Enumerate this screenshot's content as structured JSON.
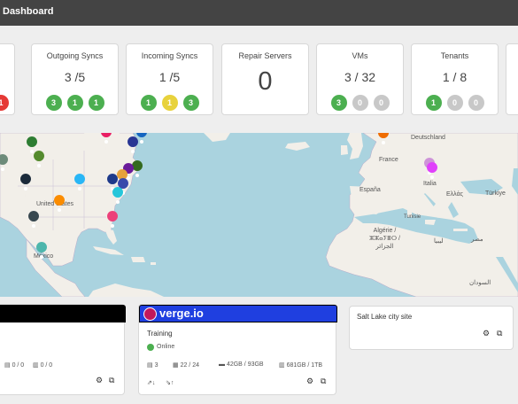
{
  "header": {
    "title": "Dashboard"
  },
  "stats": [
    {
      "title": "Outgoing Syncs",
      "value": "3 /5",
      "badges": [
        "3",
        "1",
        "1"
      ]
    },
    {
      "title": "Incoming Syncs",
      "value": "1 /5",
      "badges": [
        "1",
        "1",
        "3"
      ]
    },
    {
      "title": "Repair Servers",
      "value": "0"
    },
    {
      "title": "VMs",
      "value": "3 / 32",
      "badges": [
        "3",
        "0",
        "0"
      ]
    },
    {
      "title": "Tenants",
      "value": "1 / 8",
      "badges": [
        "1",
        "0",
        "0"
      ]
    }
  ],
  "partial_badge": "1",
  "map": {
    "labels": [
      "Deutschland",
      "France",
      "España",
      "United States",
      "México",
      "Italia",
      "Ελλάς",
      "Türkiye",
      "Algérie / ⵣⵣⴰⵢⴻⵔ / الجزائر",
      "Tunisie",
      "مصر",
      "ليبيا",
      "السودان"
    ]
  },
  "sites": {
    "left": {
      "counts": [
        "0 / 0",
        "0 / 0"
      ]
    },
    "training": {
      "logo": "verge.io",
      "name": "Training",
      "status": "Online",
      "stats": [
        "3",
        "22 / 24",
        "42GB / 93GB",
        "681GB / 1TB"
      ]
    },
    "salt_lake": {
      "name": "Salt Lake city site"
    }
  },
  "colors": {
    "green": "#4caf50",
    "yellow": "#e8d23c",
    "red": "#e53935",
    "gray": "#c8c8c8",
    "brand": "#1f3fe0"
  }
}
